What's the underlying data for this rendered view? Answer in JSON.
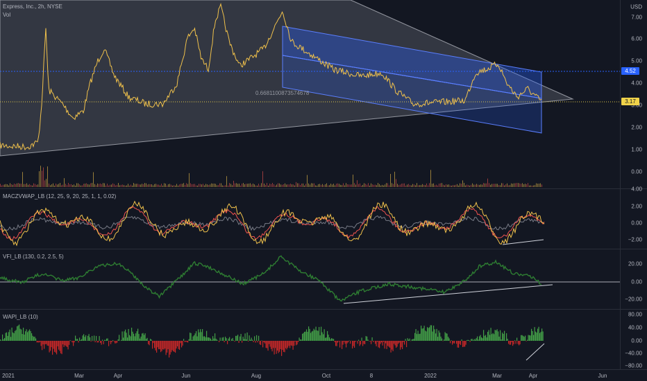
{
  "header": {
    "symbol_line": "Express, Inc., 2h, NYSE",
    "volume_label": "Vol",
    "currency": "USD"
  },
  "price_pane": {
    "axis_ticks": [
      "7.00",
      "6.00",
      "5.00",
      "4.00",
      "3.00",
      "2.00",
      "1.00",
      "0.00"
    ],
    "last_price": "3.17",
    "alert_price": "4.52",
    "fib_annotation": "0.6681100873574678",
    "colors": {
      "up": "#f0c14b",
      "down": "#ef5350",
      "channel": "#2962ff",
      "triangle": "#b2b5be"
    }
  },
  "indicators": [
    {
      "id": "maczvwap",
      "title": "MACZVWAP_LB (12, 25, 9, 20, 25, 1, 1, 0.02)",
      "axis_ticks": [
        "4.00",
        "2.00",
        "0.00",
        "−2.00"
      ]
    },
    {
      "id": "vfi",
      "title": "VFI_LB (130, 0.2, 2.5, 5)",
      "axis_ticks": [
        "20.00",
        "0.00",
        "−20.00"
      ]
    },
    {
      "id": "wapi",
      "title": "WAPI_LB (10)",
      "axis_ticks": [
        "80.00",
        "40.00",
        "0.00",
        "−40.00",
        "−80.00"
      ]
    }
  ],
  "time_axis": [
    "2021",
    "Mar",
    "Apr",
    "Jun",
    "Aug",
    "Oct",
    "8",
    "2022",
    "Mar",
    "Apr",
    "Jun"
  ]
}
